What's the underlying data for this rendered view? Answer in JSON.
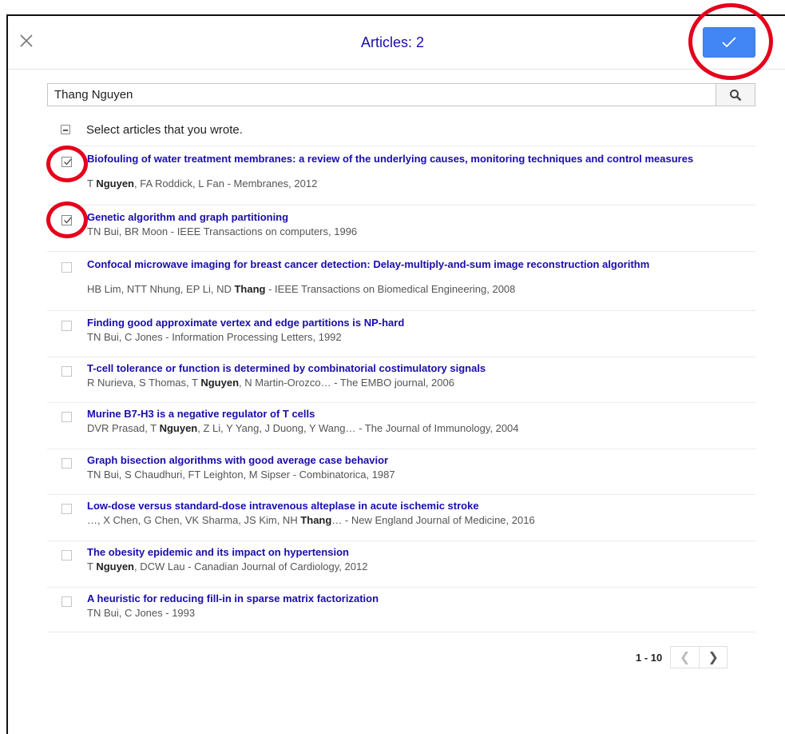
{
  "header": {
    "title": "Articles: 2"
  },
  "search": {
    "value": "Thang Nguyen"
  },
  "select_all": {
    "label": "Select articles that you wrote."
  },
  "articles": [
    {
      "title": "Biofouling of water treatment membranes: a review of the underlying causes, monitoring techniques and control measures",
      "meta": "T <b>Nguyen</b>, FA Roddick, L Fan - Membranes, 2012",
      "checked": true
    },
    {
      "title": "Genetic algorithm and graph partitioning",
      "meta": "TN Bui, BR Moon - IEEE Transactions on computers, 1996",
      "checked": true
    },
    {
      "title": "Confocal microwave imaging for breast cancer detection: Delay-multiply-and-sum image reconstruction algorithm",
      "meta": "HB Lim, NTT Nhung, EP Li, ND <b>Thang</b> - IEEE Transactions on Biomedical Engineering, 2008",
      "checked": false
    },
    {
      "title": "Finding good approximate vertex and edge partitions is NP-hard",
      "meta": "TN Bui, C Jones - Information Processing Letters, 1992",
      "checked": false
    },
    {
      "title": "T-cell tolerance or function is determined by combinatorial costimulatory signals",
      "meta": "R Nurieva, S Thomas, T <b>Nguyen</b>, N Martin-Orozco… - The EMBO journal, 2006",
      "checked": false
    },
    {
      "title": "Murine B7-H3 is a negative regulator of T cells",
      "meta": "DVR Prasad, T <b>Nguyen</b>, Z Li, Y Yang, J Duong, Y Wang… - The Journal of Immunology, 2004",
      "checked": false
    },
    {
      "title": "Graph bisection algorithms with good average case behavior",
      "meta": "TN Bui, S Chaudhuri, FT Leighton, M Sipser - Combinatorica, 1987",
      "checked": false
    },
    {
      "title": "Low-dose versus standard-dose intravenous alteplase in acute ischemic stroke",
      "meta": "…, X Chen, G Chen, VK Sharma, JS Kim, NH <b>Thang</b>… - New England Journal of Medicine, 2016",
      "checked": false
    },
    {
      "title": "The obesity epidemic and its impact on hypertension",
      "meta": "T <b>Nguyen</b>, DCW Lau - Canadian Journal of Cardiology, 2012",
      "checked": false
    },
    {
      "title": "A heuristic for reducing fill-in in sparse matrix factorization",
      "meta": "TN Bui, C Jones - 1993",
      "checked": false
    }
  ],
  "pager": {
    "range": "1 - 10"
  },
  "icons": {
    "close": "close-icon",
    "confirm": "check-icon",
    "search": "search-icon",
    "prev": "chevron-left-icon",
    "next": "chevron-right-icon"
  },
  "colors": {
    "accent": "#4285f4",
    "link": "#1a0dab",
    "annotation": "#e5001b"
  }
}
